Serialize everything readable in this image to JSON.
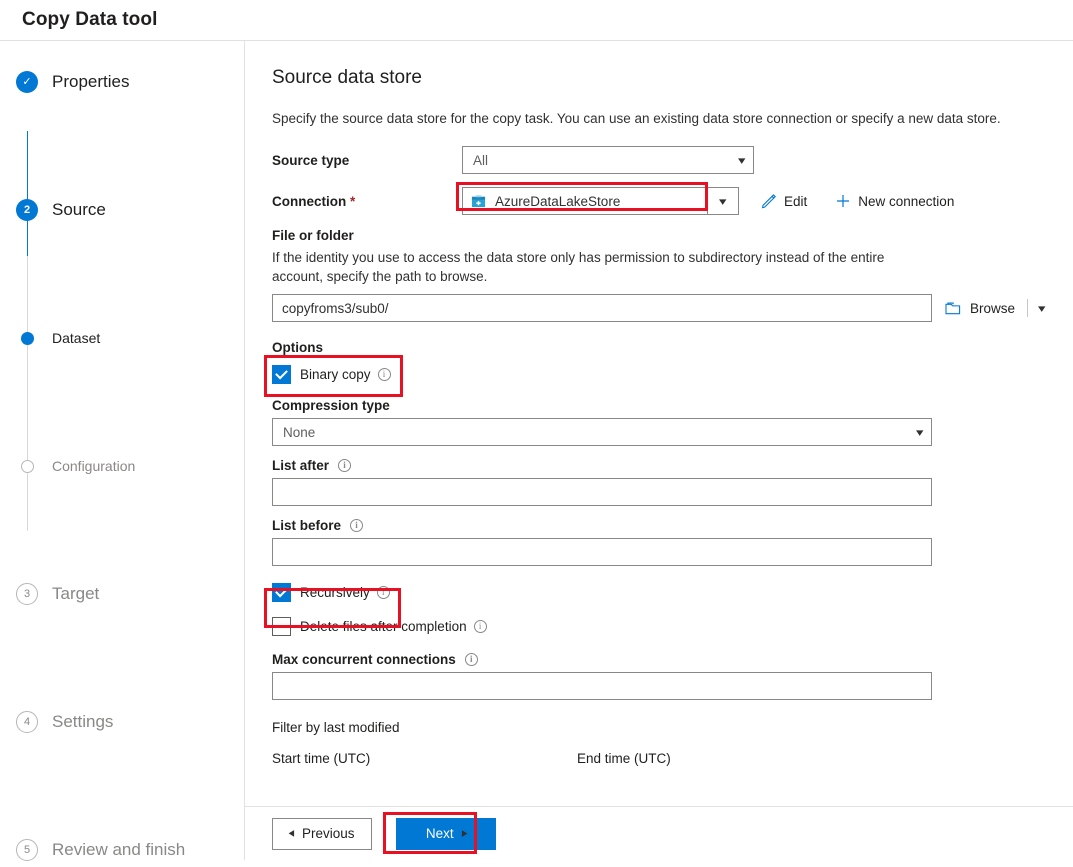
{
  "header": {
    "title": "Copy Data tool"
  },
  "sidebar": {
    "steps": [
      {
        "label": "Properties",
        "marker": "check",
        "state": "done"
      },
      {
        "label": "Source",
        "marker": "2",
        "state": "active"
      },
      {
        "label": "Dataset",
        "marker": "dot",
        "state": "active-sub"
      },
      {
        "label": "Configuration",
        "marker": "hollow-dot",
        "state": "pending-sub"
      },
      {
        "label": "Target",
        "marker": "3",
        "state": "pending"
      },
      {
        "label": "Settings",
        "marker": "4",
        "state": "pending"
      },
      {
        "label": "Review and finish",
        "marker": "5",
        "state": "pending"
      }
    ]
  },
  "main": {
    "title": "Source data store",
    "description": "Specify the source data store for the copy task. You can use an existing data store connection or specify a new data store.",
    "source_type": {
      "label": "Source type",
      "value": "All"
    },
    "connection": {
      "label": "Connection",
      "required_mark": "*",
      "value": "AzureDataLakeStore",
      "edit_label": "Edit",
      "new_connection_label": "New connection"
    },
    "file_or_folder": {
      "label": "File or folder",
      "help": "If the identity you use to access the data store only has permission to subdirectory instead of the entire account, specify the path to browse.",
      "value": "copyfroms3/sub0/",
      "browse_label": "Browse"
    },
    "options": {
      "label": "Options",
      "binary_copy": {
        "label": "Binary copy",
        "checked": true
      },
      "compression_type": {
        "label": "Compression type",
        "value": "None"
      },
      "list_after": {
        "label": "List after",
        "value": ""
      },
      "list_before": {
        "label": "List before",
        "value": ""
      },
      "recursively": {
        "label": "Recursively",
        "checked": true
      },
      "delete_files": {
        "label": "Delete files after completion",
        "checked": false
      },
      "max_concurrent_connections": {
        "label": "Max concurrent connections",
        "value": ""
      }
    },
    "filter": {
      "title": "Filter by last modified",
      "start_time_label": "Start time (UTC)",
      "end_time_label": "End time (UTC)"
    }
  },
  "footer": {
    "previous_label": "Previous",
    "next_label": "Next"
  },
  "colors": {
    "accent": "#0078d4",
    "highlight": "#e81123",
    "required": "#a4262c",
    "muted_text": "#8a8886"
  }
}
